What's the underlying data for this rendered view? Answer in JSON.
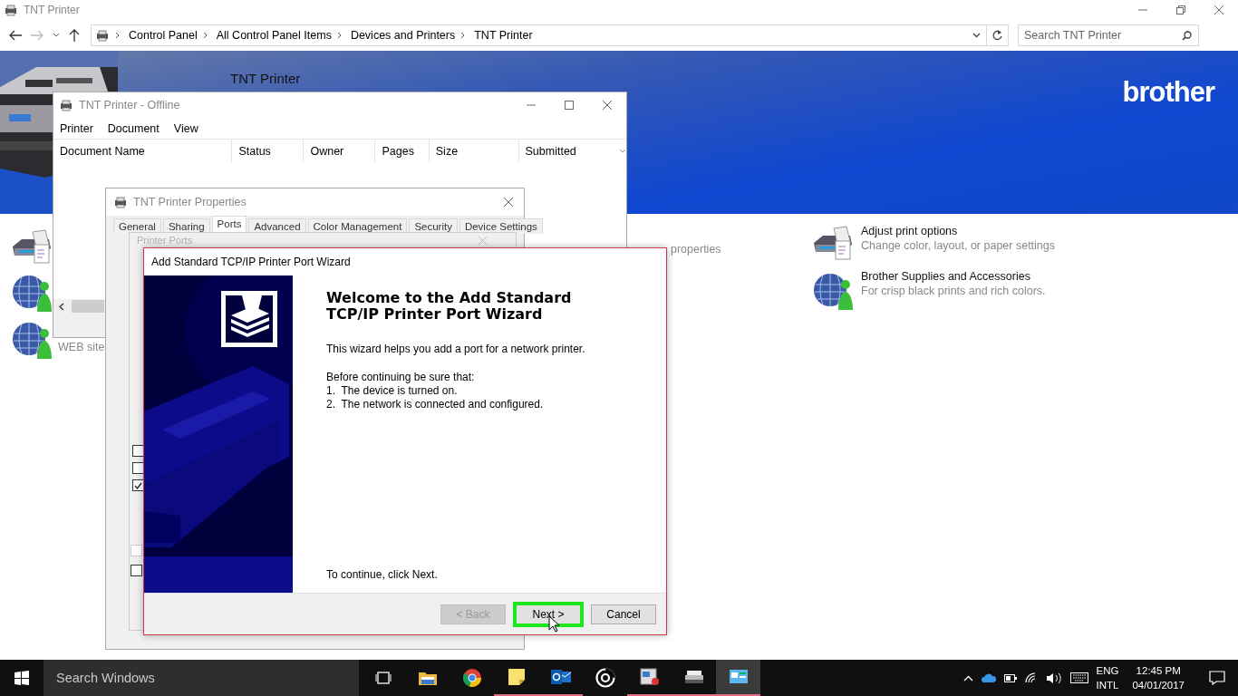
{
  "explorer": {
    "title": "TNT Printer",
    "breadcrumbs": [
      "Control Panel",
      "All Control Panel Items",
      "Devices and Printers",
      "TNT Printer"
    ],
    "search": {
      "placeholder": "Search TNT Printer"
    },
    "banner": {
      "title": "TNT Printer",
      "logo": "brother"
    },
    "left_tasks": [
      {
        "kind": "printer"
      },
      {
        "kind": "globe"
      },
      {
        "kind": "globe",
        "description": "WEB site"
      }
    ],
    "middle_task_text": "properties",
    "right_tasks": [
      {
        "kind": "printer",
        "title": "Adjust print options",
        "description": "Change color, layout, or paper settings"
      },
      {
        "kind": "globe",
        "title": "Brother Supplies and Accessories",
        "description": "For crisp black prints and rich colors."
      }
    ]
  },
  "queue_window": {
    "title": "TNT Printer - Offline",
    "menu": [
      "Printer",
      "Document",
      "View"
    ],
    "columns": [
      "Document Name",
      "Status",
      "Owner",
      "Pages",
      "Size",
      "Submitted"
    ]
  },
  "properties_window": {
    "title": "TNT Printer Properties",
    "tabs": [
      {
        "label": "General",
        "selected": false
      },
      {
        "label": "Sharing",
        "selected": false
      },
      {
        "label": "Ports",
        "selected": true
      },
      {
        "label": "Advanced",
        "selected": false
      },
      {
        "label": "Color Management",
        "selected": false
      },
      {
        "label": "Security",
        "selected": false
      },
      {
        "label": "Device Settings",
        "selected": false
      }
    ]
  },
  "ports_dialog": {
    "title": "Printer Ports",
    "port_checkboxes": [
      {
        "checked": false
      },
      {
        "checked": false
      },
      {
        "checked": true
      }
    ],
    "options": [
      {
        "checked": false,
        "disabled": true
      },
      {
        "checked": false,
        "disabled": false
      }
    ]
  },
  "wizard": {
    "title": "Add Standard TCP/IP Printer Port Wizard",
    "heading": "Welcome to the Add Standard TCP/IP Printer Port Wizard",
    "intro": "This wizard helps you add a port for a network printer.",
    "checklist_title": "Before continuing be sure that:",
    "checklist": [
      "1.  The device is turned on.",
      "2.  The network is connected and configured."
    ],
    "footer": "To continue, click Next.",
    "buttons": [
      {
        "label": "< Back",
        "disabled": true,
        "highlighted": false
      },
      {
        "label": "Next >",
        "disabled": false,
        "highlighted": true
      },
      {
        "label": "Cancel",
        "disabled": false,
        "highlighted": false
      }
    ]
  },
  "taskbar": {
    "search_placeholder": "Search Windows",
    "apps": [
      {
        "kind": "task-view",
        "running": false,
        "selected": false
      },
      {
        "kind": "folder",
        "running": false,
        "selected": false
      },
      {
        "kind": "chrome",
        "running": false,
        "selected": false
      },
      {
        "kind": "notes",
        "running": true,
        "selected": false
      },
      {
        "kind": "mail",
        "running": true,
        "selected": false
      },
      {
        "kind": "disc",
        "running": false,
        "selected": false
      },
      {
        "kind": "app",
        "running": true,
        "selected": false
      },
      {
        "kind": "printer",
        "running": true,
        "selected": false
      },
      {
        "kind": "control-panel",
        "running": true,
        "selected": true
      }
    ],
    "language": [
      "ENG",
      "INTL"
    ],
    "time": "12:45 PM",
    "date": "04/01/2017"
  }
}
